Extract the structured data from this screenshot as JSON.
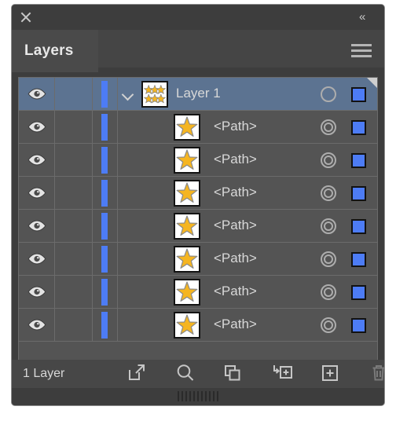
{
  "window": {
    "close_icon": "close-icon",
    "collapse_label": "«",
    "menu_icon": "hamburger-menu-icon"
  },
  "tab": {
    "label": "Layers"
  },
  "layers": {
    "rows": [
      {
        "name": "Layer 1",
        "type": "layer",
        "selected": true,
        "visible": true,
        "locked": false,
        "target": "single",
        "color": "#4d7cf5",
        "expanded": true,
        "thumb": "six-stars-thumbnail"
      },
      {
        "name": "<Path>",
        "type": "path",
        "selected": false,
        "visible": true,
        "locked": false,
        "target": "double",
        "color": "#4d7cf5",
        "thumb": "star-thumbnail"
      },
      {
        "name": "<Path>",
        "type": "path",
        "selected": false,
        "visible": true,
        "locked": false,
        "target": "double",
        "color": "#4d7cf5",
        "thumb": "star-thumbnail"
      },
      {
        "name": "<Path>",
        "type": "path",
        "selected": false,
        "visible": true,
        "locked": false,
        "target": "double",
        "color": "#4d7cf5",
        "thumb": "star-thumbnail"
      },
      {
        "name": "<Path>",
        "type": "path",
        "selected": false,
        "visible": true,
        "locked": false,
        "target": "double",
        "color": "#4d7cf5",
        "thumb": "star-thumbnail"
      },
      {
        "name": "<Path>",
        "type": "path",
        "selected": false,
        "visible": true,
        "locked": false,
        "target": "double",
        "color": "#4d7cf5",
        "thumb": "star-thumbnail"
      },
      {
        "name": "<Path>",
        "type": "path",
        "selected": false,
        "visible": true,
        "locked": false,
        "target": "double",
        "color": "#4d7cf5",
        "thumb": "star-thumbnail"
      },
      {
        "name": "<Path>",
        "type": "path",
        "selected": false,
        "visible": true,
        "locked": false,
        "target": "double",
        "color": "#4d7cf5",
        "thumb": "star-thumbnail"
      }
    ]
  },
  "status": {
    "count_label": "1 Layer"
  },
  "toolbar": {
    "buttons": [
      {
        "name": "release-to-layers-button",
        "icon": "export-arrow-icon",
        "enabled": true
      },
      {
        "name": "locate-object-button",
        "icon": "magnifier-icon",
        "enabled": true
      },
      {
        "name": "duplicate-layer-button",
        "icon": "copy-squares-icon",
        "enabled": true
      },
      {
        "name": "new-sublayer-button",
        "icon": "sublayer-plus-icon",
        "enabled": true
      },
      {
        "name": "new-layer-button",
        "icon": "square-plus-icon",
        "enabled": true
      },
      {
        "name": "delete-layer-button",
        "icon": "trash-icon",
        "enabled": false
      }
    ]
  },
  "colors": {
    "panel_bg": "#3d3d3d",
    "row_bg": "#545454",
    "row_selected_bg": "#5c7391",
    "accent_blue": "#4d7cf5",
    "star_gold": "#f5b521",
    "text": "#d8d8d8"
  }
}
